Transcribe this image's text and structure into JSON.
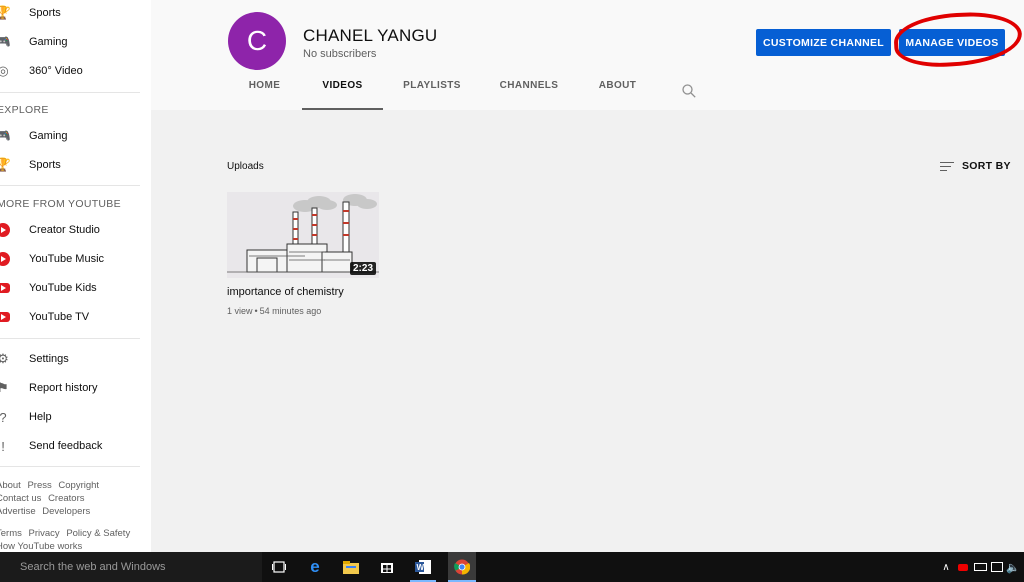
{
  "sidebar": {
    "top_items": [
      {
        "label": "Sports",
        "icon": "trophy-icon"
      },
      {
        "label": "Gaming",
        "icon": "gamepad-icon"
      },
      {
        "label": "360° Video",
        "icon": "vr-360-icon"
      }
    ],
    "explore_heading": "EXPLORE",
    "explore_items": [
      {
        "label": "Gaming",
        "icon": "gamepad-icon"
      },
      {
        "label": "Sports",
        "icon": "trophy-icon"
      }
    ],
    "more_heading": "MORE FROM YOUTUBE",
    "more_items": [
      {
        "label": "Creator Studio",
        "icon": "creator-studio-icon"
      },
      {
        "label": "YouTube Music",
        "icon": "youtube-music-icon"
      },
      {
        "label": "YouTube Kids",
        "icon": "youtube-kids-icon"
      },
      {
        "label": "YouTube TV",
        "icon": "youtube-tv-icon"
      }
    ],
    "settings_items": [
      {
        "label": "Settings",
        "icon": "gear-icon"
      },
      {
        "label": "Report history",
        "icon": "flag-icon"
      },
      {
        "label": "Help",
        "icon": "help-icon"
      },
      {
        "label": "Send feedback",
        "icon": "feedback-icon"
      }
    ],
    "footer": {
      "row1": [
        "About",
        "Press",
        "Copyright"
      ],
      "row2": [
        "Contact us",
        "Creators"
      ],
      "row3": [
        "Advertise",
        "Developers"
      ],
      "row4": [
        "Terms",
        "Privacy",
        "Policy & Safety"
      ],
      "row5": [
        "How YouTube works"
      ]
    }
  },
  "channel": {
    "avatar_letter": "C",
    "avatar_color": "#8e24aa",
    "name": "CHANEL YANGU",
    "subscribers": "No subscribers",
    "customize_label": "CUSTOMIZE CHANNEL",
    "manage_label": "MANAGE VIDEOS",
    "button_color": "#065fd4"
  },
  "tabs": [
    {
      "label": "HOME",
      "active": false
    },
    {
      "label": "VIDEOS",
      "active": true
    },
    {
      "label": "PLAYLISTS",
      "active": false
    },
    {
      "label": "CHANNELS",
      "active": false
    },
    {
      "label": "ABOUT",
      "active": false
    }
  ],
  "uploads": {
    "heading": "Uploads",
    "sort_label": "SORT BY",
    "videos": [
      {
        "title": "importance of chemistry",
        "duration": "2:23",
        "views": "1 view",
        "age": "54 minutes ago"
      }
    ]
  },
  "annotation": {
    "color": "#e00000"
  },
  "taskbar": {
    "search_placeholder": "Search the web and Windows",
    "apps": [
      "task-view-icon",
      "edge-icon",
      "file-explorer-icon",
      "store-icon",
      "word-icon",
      "chrome-icon"
    ]
  }
}
